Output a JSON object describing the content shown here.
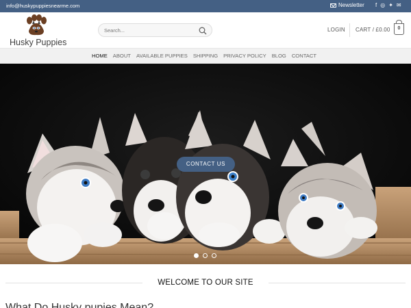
{
  "topbar": {
    "email": "info@huskypuppiesnearme.com",
    "newsletter_label": "Newsletter",
    "socials": [
      {
        "name": "facebook-icon",
        "glyph": "f"
      },
      {
        "name": "instagram-icon",
        "glyph": "◎"
      },
      {
        "name": "twitter-icon",
        "glyph": "✦"
      },
      {
        "name": "email-icon",
        "glyph": "✉"
      }
    ],
    "bg_color": "#446084"
  },
  "header": {
    "logo_text": "Husky Puppies",
    "search_placeholder": "Search...",
    "login_label": "LOGIN",
    "cart_label": "CART / £0.00",
    "cart_count": "0"
  },
  "nav": {
    "items": [
      "HOME",
      "ABOUT",
      "AVAILABLE PUPPIES",
      "SHIPPING",
      "PRIVACY POLICY",
      "BLOG",
      "CONTACT"
    ]
  },
  "hero": {
    "cta_label": "CONTACT US",
    "slide_count": 3,
    "active_slide": 1,
    "accent_color": "#446084"
  },
  "welcome": {
    "title": "WELCOME TO OUR SITE",
    "subtitle_partial": "What Do Husky pupies Mean?"
  }
}
